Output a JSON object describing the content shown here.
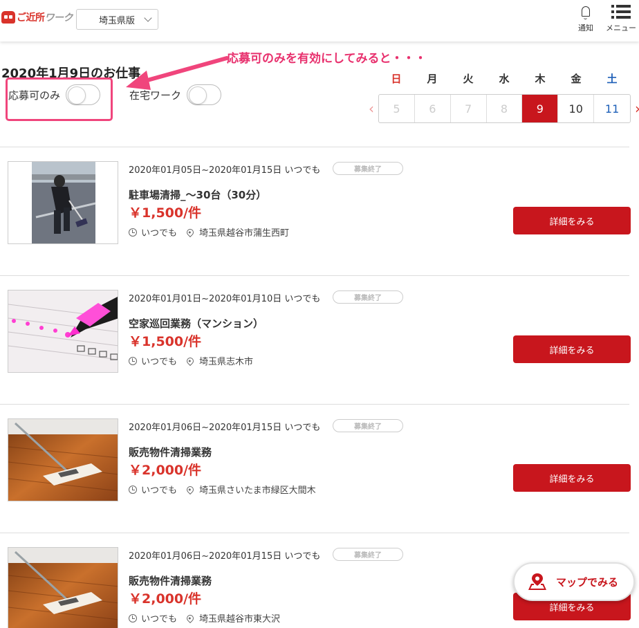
{
  "header": {
    "logo_main": "ご近所",
    "logo_sub": "ワーク",
    "region": "埼玉県版",
    "notify_label": "通知",
    "menu_label": "メニュー"
  },
  "page": {
    "title": "2020年1月9日のお仕事",
    "annotation": "応募可のみを有効にしてみると・・・"
  },
  "filters": {
    "apply_only": "応募可のみ",
    "remote": "在宅ワーク"
  },
  "calendar": {
    "weekdays": [
      "日",
      "月",
      "火",
      "水",
      "木",
      "金",
      "土"
    ],
    "days": [
      "5",
      "6",
      "7",
      "8",
      "9",
      "10",
      "11"
    ],
    "selected": "9",
    "prev": "‹",
    "next": "›"
  },
  "jobs": [
    {
      "dates": "2020年01月05日~2020年01月15日 いつでも",
      "badge": "募集終了",
      "title": "駐車場清掃_～30台（30分）",
      "price": "￥1,500/件",
      "time": "いつでも",
      "location": "埼玉県越谷市蒲生西町",
      "button": "詳細をみる"
    },
    {
      "dates": "2020年01月01日~2020年01月10日 いつでも",
      "badge": "募集終了",
      "title": "空家巡回業務（マンション）",
      "price": "￥1,500/件",
      "time": "いつでも",
      "location": "埼玉県志木市",
      "button": "詳細をみる"
    },
    {
      "dates": "2020年01月06日~2020年01月15日 いつでも",
      "badge": "募集終了",
      "title": "販売物件清掃業務",
      "price": "￥2,000/件",
      "time": "いつでも",
      "location": "埼玉県さいたま市緑区大間木",
      "button": "詳細をみる"
    },
    {
      "dates": "2020年01月06日~2020年01月15日 いつでも",
      "badge": "募集終了",
      "title": "販売物件清掃業務",
      "price": "￥2,000/件",
      "time": "いつでも",
      "location": "埼玉県越谷市東大沢",
      "button": "詳細をみる"
    }
  ],
  "map_button": "マップでみる",
  "colors": {
    "accent_red": "#c8161d",
    "annotation_pink": "#e8316e",
    "sunday": "#d9332b",
    "saturday": "#1d5fb8"
  }
}
